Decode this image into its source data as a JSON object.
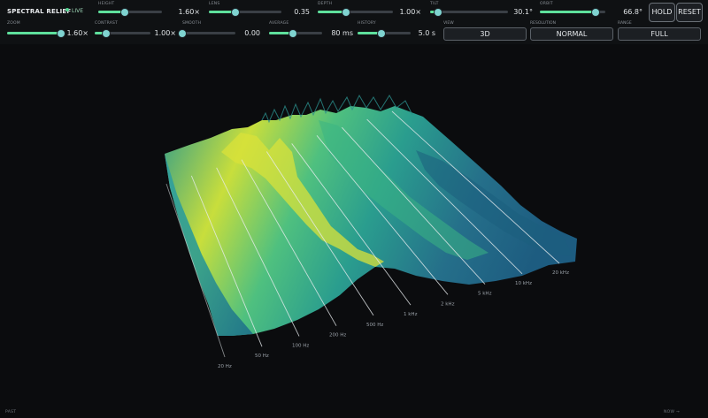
{
  "app": {
    "title": "SPECTRAL RELIEF",
    "status": "LIVE"
  },
  "controls": {
    "height": {
      "label": "HEIGHT",
      "value": "1.60×",
      "fraction": 0.42
    },
    "lens": {
      "label": "LENS",
      "value": "0.35",
      "fraction": 0.37
    },
    "depth": {
      "label": "DEPTH",
      "value": "1.00×",
      "fraction": 0.38
    },
    "tilt": {
      "label": "TILT",
      "value": "30.1°",
      "fraction": 0.1
    },
    "orbit": {
      "label": "ORBIT",
      "value": "66.8°",
      "fraction": 0.85
    },
    "zoom": {
      "label": "ZOOM",
      "value": "1.60×",
      "fraction": 0.95
    },
    "contrast": {
      "label": "CONTRAST",
      "value": "1.00×",
      "fraction": 0.2
    },
    "smooth": {
      "label": "SMOOTH",
      "value": "0.00",
      "fraction": 0.0
    },
    "average": {
      "label": "AVERAGE",
      "value": "80 ms",
      "fraction": 0.45
    },
    "history": {
      "label": "HISTORY",
      "value": "5.0 s",
      "fraction": 0.45
    },
    "view": {
      "label": "VIEW",
      "value": "3D"
    },
    "resolution": {
      "label": "RESOLUTION",
      "value": "NORMAL"
    },
    "range": {
      "label": "RANGE",
      "value": "FULL"
    }
  },
  "buttons": {
    "hold": "HOLD",
    "reset": "RESET"
  },
  "freq_labels": [
    "20 Hz",
    "50 Hz",
    "100 Hz",
    "200 Hz",
    "500 Hz",
    "1 kHz",
    "2 kHz",
    "5 kHz",
    "10 kHz",
    "20 kHz"
  ],
  "footer": {
    "past": "PAST",
    "now": "NOW →"
  },
  "colors": {
    "accent": "#5ee09c",
    "surface_low": "#1f6f86",
    "surface_mid": "#27b18a",
    "surface_high": "#e2e23a"
  }
}
